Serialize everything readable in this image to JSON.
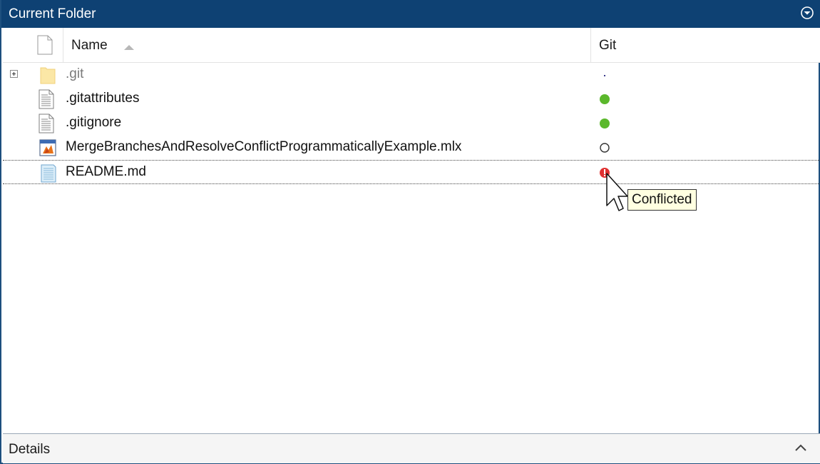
{
  "panel": {
    "title": "Current Folder",
    "menu_icon": "circle-chevron-down-icon",
    "accent_color": "#0e4173"
  },
  "columns": {
    "name": "Name",
    "git": "Git",
    "sort": "ascending"
  },
  "files": [
    {
      "name": ".git",
      "type": "folder",
      "status": "untracked-dot",
      "expandable": true
    },
    {
      "name": ".gitattributes",
      "type": "text-file",
      "status": "unmodified"
    },
    {
      "name": ".gitignore",
      "type": "text-file",
      "status": "unmodified"
    },
    {
      "name": "MergeBranchesAndResolveConflictProgrammaticallyExample.mlx",
      "type": "live-script",
      "status": "not-under-source-control"
    },
    {
      "name": "README.md",
      "type": "markdown-file",
      "status": "conflicted",
      "selected": true
    }
  ],
  "status_colors": {
    "unmodified": "#5bb82c",
    "conflicted": "#e03030"
  },
  "tooltip": {
    "text": "Conflicted"
  },
  "details": {
    "label": "Details",
    "icon": "chevron-up-icon"
  }
}
